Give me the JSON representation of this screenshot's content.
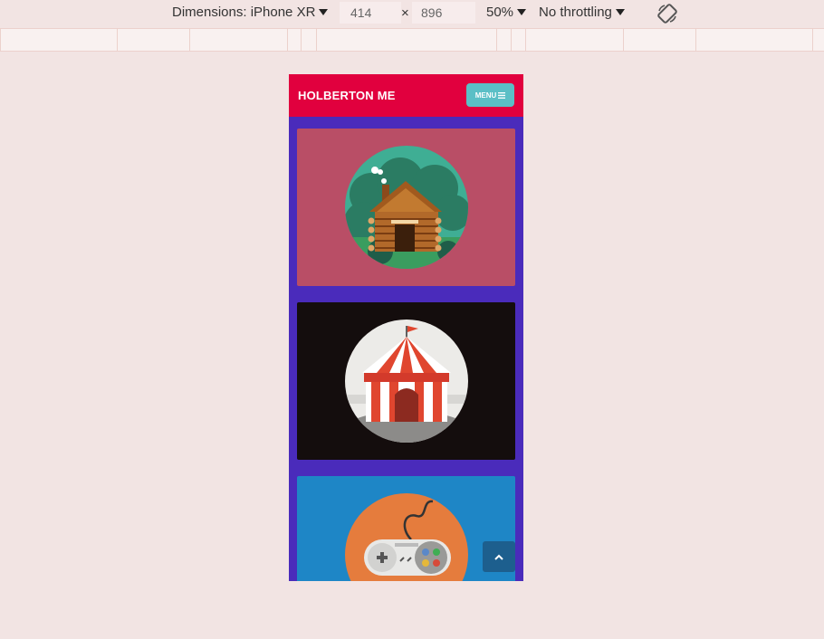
{
  "devtools": {
    "dimensions_label": "Dimensions: iPhone XR",
    "width": "414",
    "height": "896",
    "times": "×",
    "zoom": "50%",
    "throttling": "No throttling",
    "rotate_icon": "rotate-icon"
  },
  "site": {
    "brand": "HOLBERTON ME",
    "menu_label": "MENU",
    "menu_icon": "hamburger-icon",
    "colors": {
      "header": "#e1003e",
      "page_bg": "#4a2bbb",
      "menu_button": "#5bbfc6"
    },
    "cards": [
      {
        "illustration": "log-cabin-icon",
        "background": "#b94e66"
      },
      {
        "illustration": "circus-tent-icon",
        "background": "#140d0d"
      },
      {
        "illustration": "game-controller-icon",
        "background": "#1e86c6"
      }
    ],
    "scroll_top_icon": "chevron-up-icon"
  }
}
